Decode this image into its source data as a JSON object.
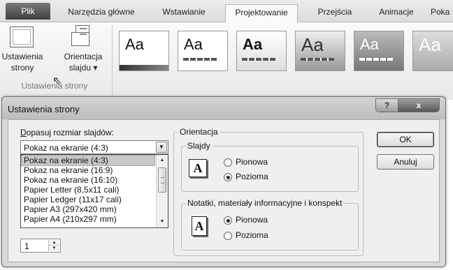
{
  "ribbon": {
    "tabs": [
      {
        "label": "Plik"
      },
      {
        "label": "Narzędzia główne"
      },
      {
        "label": "Wstawianie"
      },
      {
        "label": "Projektowanie"
      },
      {
        "label": "Przejścia"
      },
      {
        "label": "Animacje"
      },
      {
        "label": "Poka"
      }
    ],
    "active_tab": "Projektowanie",
    "page_setup": {
      "line1": "Ustawienia",
      "line2": "strony"
    },
    "orientation": {
      "line1": "Orientacja",
      "line2": "slajdu ▾"
    },
    "group_label": "Ustawienia strony",
    "theme_glyph": "Aa"
  },
  "dialog": {
    "title": "Ustawienia strony",
    "help_glyph": "?",
    "close_glyph": "x",
    "size_label": "Dopasuj rozmiar slajdów:",
    "size_selected": "Pokaz na ekranie (4:3)",
    "size_options": [
      "Pokaz na ekranie (4:3)",
      "Pokaz na ekranie (16:9)",
      "Pokaz na ekranie (16:10)",
      "Papier Letter (8,5x11 cali)",
      "Papier Ledger (11x17 cali)",
      "Papier A3 (297x420 mm)",
      "Papier A4 (210x297 mm)"
    ],
    "number_value": "1",
    "orientation_label": "Orientacja",
    "slides_label": "Slajdy",
    "slides_portrait": "Pionowa",
    "slides_landscape": "Pozioma",
    "slides_selected": "landscape",
    "notes_label": "Notatki, materiały informacyjne i konspekt",
    "notes_portrait": "Pionowa",
    "notes_landscape": "Pozioma",
    "notes_selected": "portrait",
    "icon_letter": "A",
    "ok_label": "OK",
    "cancel_label": "Anuluj"
  }
}
